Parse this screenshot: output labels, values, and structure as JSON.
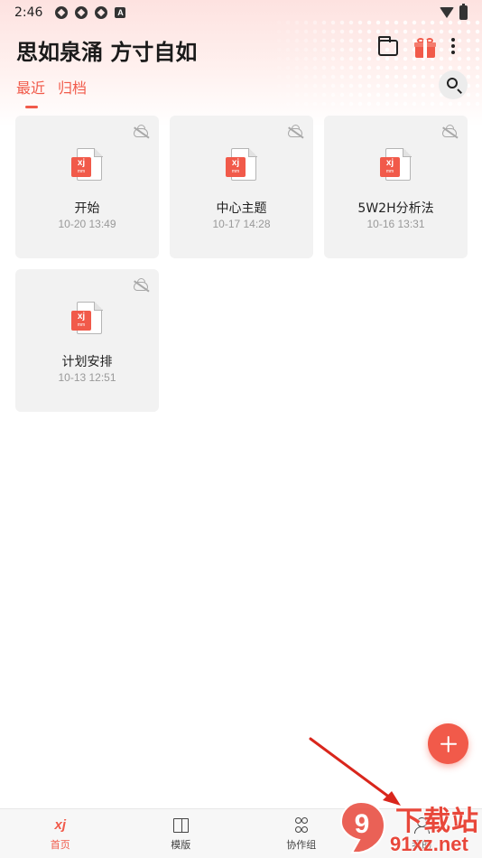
{
  "status_bar": {
    "time": "2:46",
    "notification_icons": [
      "media-icon",
      "media-icon",
      "media-icon",
      "a-icon"
    ],
    "a_label": "A"
  },
  "header": {
    "title": "思如泉涌 方寸自如",
    "icons": [
      "folder-icon",
      "gift-icon",
      "more-icon"
    ]
  },
  "tabs": [
    {
      "label": "最近",
      "active": true
    },
    {
      "label": "归档",
      "active": false
    }
  ],
  "files": [
    {
      "name": "开始",
      "date": "10-20 13:49"
    },
    {
      "name": "中心主题",
      "date": "10-17 14:28"
    },
    {
      "name": "5W2H分析法",
      "date": "10-16 13:31"
    },
    {
      "name": "计划安排",
      "date": "10-13 12:51"
    }
  ],
  "file_badge": {
    "mark": "xj",
    "sub": "mm"
  },
  "bottom_nav": [
    {
      "label": "首页",
      "icon": "home-logo-icon",
      "active": true
    },
    {
      "label": "模版",
      "icon": "template-book-icon",
      "active": false
    },
    {
      "label": "协作组",
      "icon": "team-icon",
      "active": false
    },
    {
      "label": "我的",
      "icon": "profile-icon",
      "active": false
    }
  ],
  "watermark": {
    "top_text": "下载站",
    "bottom_text": "91xz.net",
    "badge_text": "9"
  },
  "colors": {
    "accent": "#f15a4a",
    "card_bg": "#f2f2f2",
    "header_gradient": "#fde2e0",
    "arrow": "#d9261c"
  }
}
